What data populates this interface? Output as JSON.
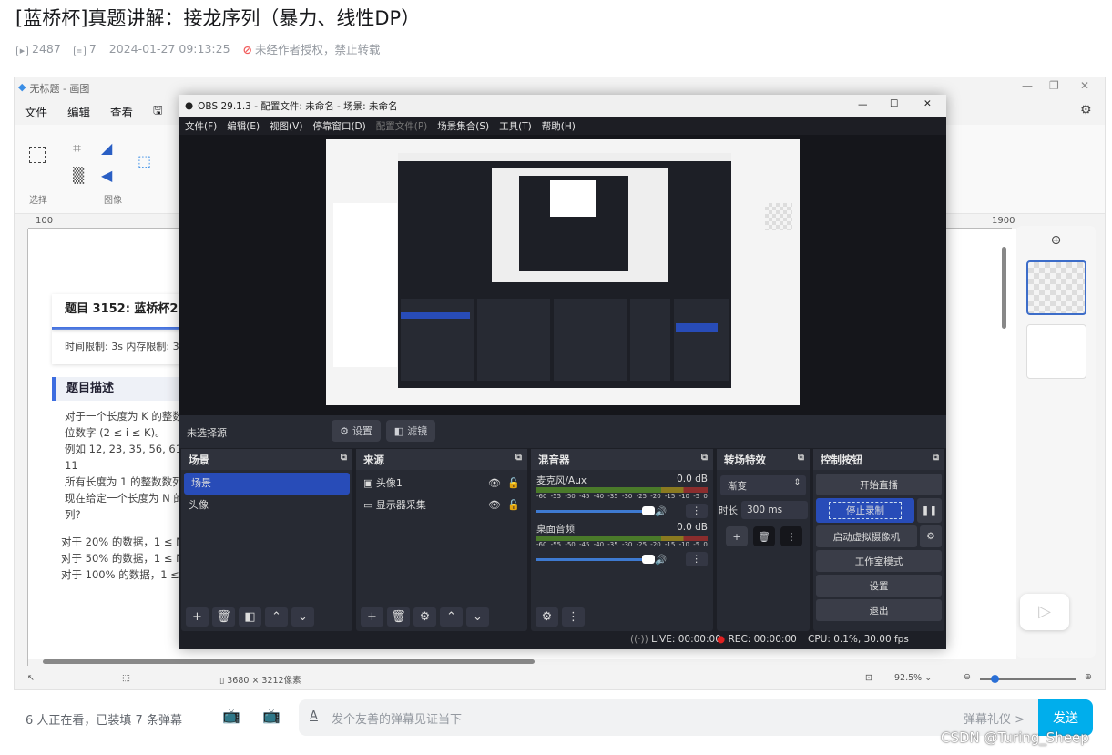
{
  "video": {
    "title": "[蓝桥杯]真题讲解：接龙序列（暴力、线性DP）",
    "views": "2487",
    "danmaku_count": "7",
    "date": "2024-01-27 09:13:25",
    "copyright": "未经作者授权，禁止转载"
  },
  "paint": {
    "title": "无标题 - 画图",
    "menu": [
      "文件",
      "编辑",
      "查看"
    ],
    "ribbon_groups": [
      "选择",
      "图像"
    ],
    "ruler_ticks": [
      "100",
      "1900"
    ],
    "doc": {
      "problem_title": "题目 3152: 蓝桥杯20",
      "limits": "时间限制: 3s 内存限制: 3",
      "section": "题目描述",
      "lines": [
        "对于一个长度为 K 的整数",
        "位数字 (2 ≤ i ≤ K)。",
        "例如 12, 23, 35, 56, 61, 11",
        "所有长度为 1 的整数数列",
        "现在给定一个长度为 N 的",
        "列?"
      ],
      "data_lines": [
        "对于 20% 的数据，1 ≤ N",
        "对于 50% 的数据，1 ≤ N",
        "对于 100% 的数据，1 ≤ N"
      ]
    },
    "status": {
      "size": "3680 × 3212像素",
      "zoom": "92.5%"
    }
  },
  "obs": {
    "title": "OBS 29.1.3 - 配置文件: 未命名 - 场景: 未命名",
    "menu": [
      "文件(F)",
      "编辑(E)",
      "视图(V)",
      "停靠窗口(D)",
      "配置文件(P)",
      "场景集合(S)",
      "工具(T)",
      "帮助(H)"
    ],
    "no_source": "未选择源",
    "settings_btn": "设置",
    "filters_btn": "滤镜",
    "scenes": {
      "title": "场景",
      "items": [
        "场景",
        "头像"
      ]
    },
    "sources": {
      "title": "来源",
      "items": [
        "头像1",
        "显示器采集"
      ]
    },
    "mixer": {
      "title": "混音器",
      "channels": [
        {
          "name": "麦克风/Aux",
          "level": "0.0 dB"
        },
        {
          "name": "桌面音频",
          "level": "0.0 dB"
        }
      ],
      "scale": [
        "-60",
        "-55",
        "-50",
        "-45",
        "-40",
        "-35",
        "-30",
        "-25",
        "-20",
        "-15",
        "-10",
        "-5",
        "0"
      ]
    },
    "transitions": {
      "title": "转场特效",
      "type": "渐变",
      "duration_label": "时长",
      "duration": "300 ms"
    },
    "controls": {
      "title": "控制按钮",
      "buttons": [
        "开始直播",
        "停止录制",
        "启动虚拟摄像机",
        "工作室模式",
        "设置",
        "退出"
      ]
    },
    "status": {
      "live": "LIVE: 00:00:00",
      "rec": "REC: 00:00:00",
      "cpu": "CPU: 0.1%, 30.00 fps"
    },
    "accent": "#284cb8"
  },
  "danmaku": {
    "watching": "6 人正在看，已装填 7 条弹幕",
    "placeholder": "发个友善的弹幕见证当下",
    "etiquette": "弹幕礼仪 >",
    "send": "发送",
    "accent": "#00aeec"
  },
  "watermark": "CSDN @Turing_Sheep"
}
